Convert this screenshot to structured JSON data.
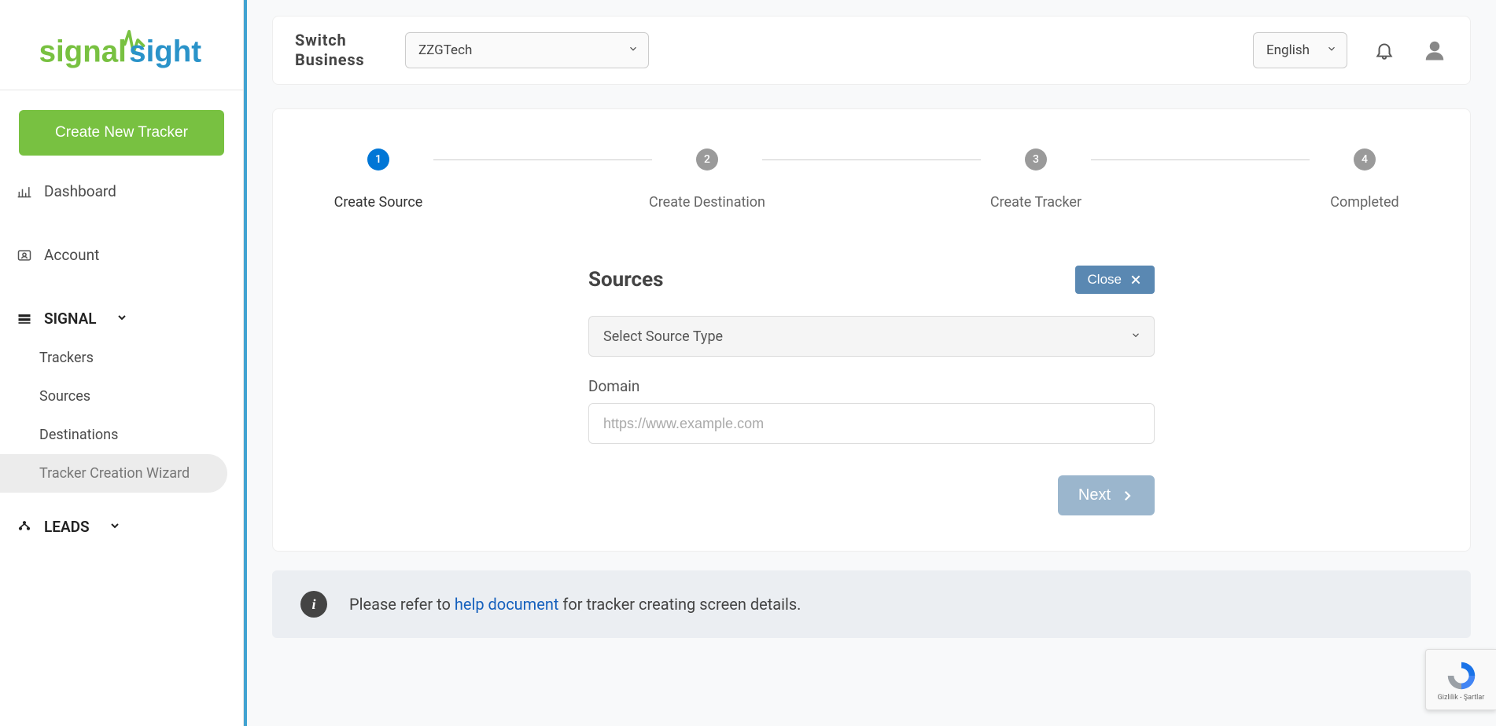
{
  "logo": {
    "text1": "signal",
    "text2": "sight"
  },
  "sidebar": {
    "create_btn": "Create New Tracker",
    "dashboard": "Dashboard",
    "account": "Account",
    "signal": "SIGNAL",
    "signal_items": [
      "Trackers",
      "Sources",
      "Destinations",
      "Tracker Creation Wizard"
    ],
    "leads": "LEADS"
  },
  "topbar": {
    "switch_label": "Switch Business",
    "business_value": "ZZGTech",
    "lang_value": "English"
  },
  "steps": [
    {
      "num": "1",
      "label": "Create Source"
    },
    {
      "num": "2",
      "label": "Create Destination"
    },
    {
      "num": "3",
      "label": "Create Tracker"
    },
    {
      "num": "4",
      "label": "Completed"
    }
  ],
  "form": {
    "title": "Sources",
    "close_label": "Close",
    "source_type_placeholder": "Select Source Type",
    "domain_label": "Domain",
    "domain_placeholder": "https://www.example.com",
    "next_label": "Next"
  },
  "info": {
    "pre": "Please refer to ",
    "link": "help document",
    "post": " for tracker creating screen details."
  },
  "recaptcha": {
    "caption": "Gizlilik - Şartlar"
  }
}
